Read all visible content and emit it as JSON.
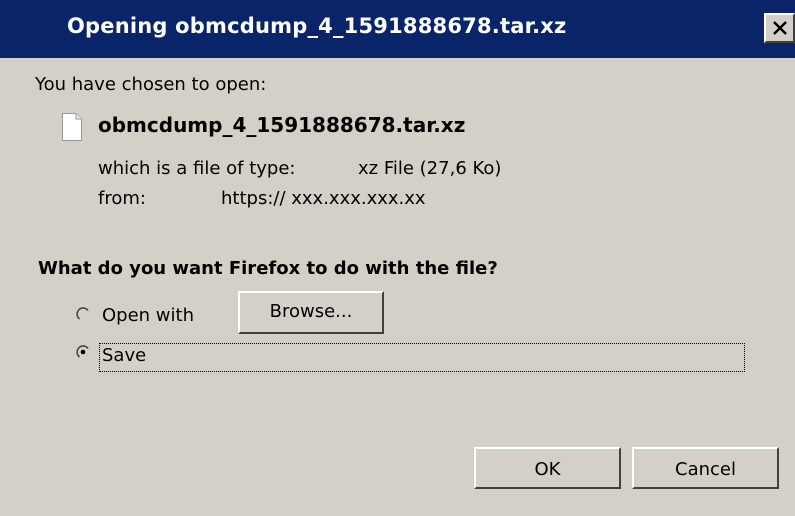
{
  "window": {
    "title": "Opening obmcdump_4_1591888678.tar.xz",
    "close_icon": "close-icon"
  },
  "content": {
    "intro": "You have chosen to open:",
    "file_icon": "file-icon",
    "filename": "obmcdump_4_1591888678.tar.xz",
    "type_label": "which is a file of type:",
    "type_value": "xz File (27,6 Ko)",
    "from_label": "from:",
    "from_value": "https:// xxx.xxx.xxx.xx"
  },
  "question": "What do you want Firefox to do with the file?",
  "options": {
    "open_with_label": "Open with",
    "open_with_selected": false,
    "browse_label": "Browse...",
    "save_label": "Save",
    "save_selected": true
  },
  "buttons": {
    "ok": "OK",
    "cancel": "Cancel"
  },
  "colors": {
    "titlebar": "#0a246a",
    "dialog_bg": "#d4d0c8"
  }
}
